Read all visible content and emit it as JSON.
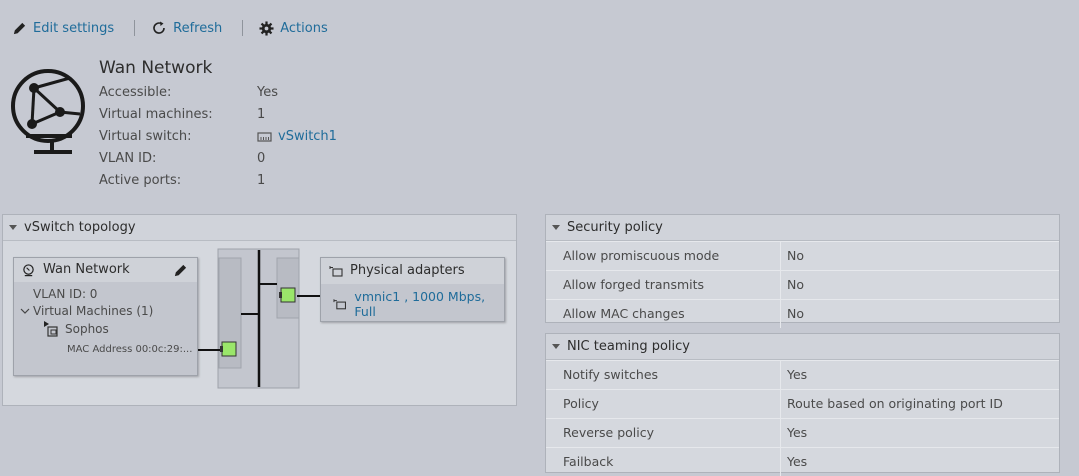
{
  "toolbar": {
    "edit_label": "Edit settings",
    "refresh_label": "Refresh",
    "actions_label": "Actions"
  },
  "network": {
    "title": "Wan Network",
    "properties": [
      {
        "label": "Accessible:",
        "value": "Yes"
      },
      {
        "label": "Virtual machines:",
        "value": "1"
      },
      {
        "label": "Virtual switch:",
        "value": "vSwitch1"
      },
      {
        "label": "VLAN ID:",
        "value": "0"
      },
      {
        "label": "Active ports:",
        "value": "1"
      }
    ]
  },
  "topology": {
    "header": "vSwitch topology",
    "portgroup": {
      "name": "Wan Network",
      "vlan": "VLAN ID: 0",
      "vms_label": "Virtual Machines (1)",
      "vm_name": "Sophos",
      "mac": "MAC Address 00:0c:29:..."
    },
    "adapters": {
      "title": "Physical adapters",
      "nic": "vmnic1 , 1000 Mbps, Full"
    }
  },
  "security": {
    "header": "Security policy",
    "rows": [
      {
        "label": "Allow promiscuous mode",
        "value": "No"
      },
      {
        "label": "Allow forged transmits",
        "value": "No"
      },
      {
        "label": "Allow MAC changes",
        "value": "No"
      }
    ]
  },
  "teaming": {
    "header": "NIC teaming policy",
    "rows": [
      {
        "label": "Notify switches",
        "value": "Yes"
      },
      {
        "label": "Policy",
        "value": "Route based on originating port ID"
      },
      {
        "label": "Reverse policy",
        "value": "Yes"
      },
      {
        "label": "Failback",
        "value": "Yes"
      }
    ]
  },
  "colors": {
    "link": "#1f6c9a",
    "port_green": "#9ae66a",
    "background": "#c6c9d2"
  }
}
